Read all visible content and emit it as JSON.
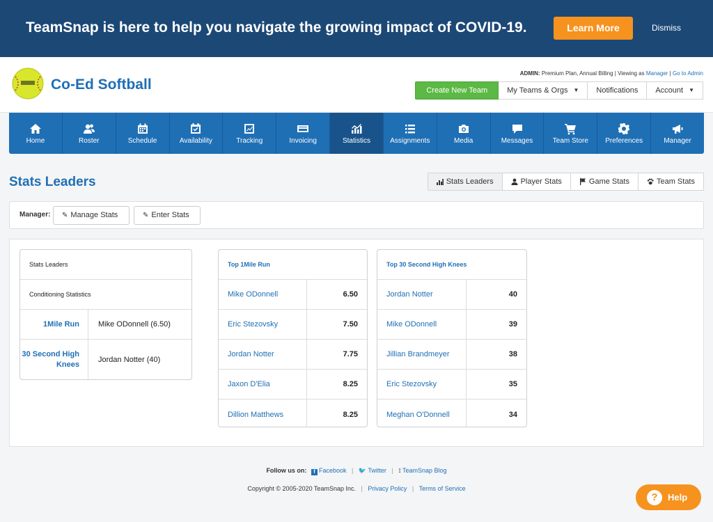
{
  "banner": {
    "text": "TeamSnap is here to help you navigate the growing impact of COVID-19.",
    "learn_more": "Learn More",
    "dismiss": "Dismiss"
  },
  "header": {
    "team_name": "Co-Ed Softball",
    "admin_prefix": "ADMIN:",
    "admin_plan": " Premium Plan, Annual Billing | Viewing as ",
    "viewing_as": "Manager",
    "admin_sep": " | ",
    "go_to_admin": "Go to Admin",
    "create_team": "Create New Team",
    "my_teams": "My Teams & Orgs",
    "notifications": "Notifications",
    "account": "Account"
  },
  "nav": {
    "items": [
      {
        "label": "Home",
        "icon": "home-icon"
      },
      {
        "label": "Roster",
        "icon": "roster-icon"
      },
      {
        "label": "Schedule",
        "icon": "calendar-icon"
      },
      {
        "label": "Availability",
        "icon": "availability-icon"
      },
      {
        "label": "Tracking",
        "icon": "tracking-icon"
      },
      {
        "label": "Invoicing",
        "icon": "credit-card-icon"
      },
      {
        "label": "Statistics",
        "icon": "statistics-icon",
        "active": true
      },
      {
        "label": "Assignments",
        "icon": "list-icon"
      },
      {
        "label": "Media",
        "icon": "camera-icon"
      },
      {
        "label": "Messages",
        "icon": "message-icon"
      },
      {
        "label": "Team Store",
        "icon": "cart-icon"
      },
      {
        "label": "Preferences",
        "icon": "gear-icon"
      },
      {
        "label": "Manager",
        "icon": "megaphone-icon"
      }
    ]
  },
  "page": {
    "title": "Stats Leaders",
    "tabs": [
      "Stats Leaders",
      "Player Stats",
      "Game Stats",
      "Team Stats"
    ]
  },
  "manager_bar": {
    "label": "Manager:",
    "manage_stats": "Manage Stats",
    "enter_stats": "Enter Stats"
  },
  "summary": {
    "header": "Stats Leaders",
    "subheader": "Conditioning Statistics",
    "rows": [
      {
        "stat": "1Mile Run",
        "leader": "Mike ODonnell (6.50)"
      },
      {
        "stat": "30 Second High Knees",
        "leader": "Jordan Notter (40)"
      }
    ]
  },
  "boards": [
    {
      "title": "Top 1Mile Run",
      "rows": [
        {
          "name": "Mike ODonnell",
          "value": "6.50"
        },
        {
          "name": "Eric Stezovsky",
          "value": "7.50"
        },
        {
          "name": "Jordan Notter",
          "value": "7.75"
        },
        {
          "name": "Jaxon D'Elia",
          "value": "8.25"
        },
        {
          "name": "Dillion Matthews",
          "value": "8.25"
        }
      ]
    },
    {
      "title": "Top 30 Second High Knees",
      "rows": [
        {
          "name": "Jordan Notter",
          "value": "40"
        },
        {
          "name": "Mike ODonnell",
          "value": "39"
        },
        {
          "name": "Jillian Brandmeyer",
          "value": "38"
        },
        {
          "name": "Eric Stezovsky",
          "value": "35"
        },
        {
          "name": "Meghan O'Donnell",
          "value": "34"
        }
      ]
    }
  ],
  "footer": {
    "follow_label": "Follow us on:",
    "facebook": "Facebook",
    "twitter": "Twitter",
    "blog": "TeamSnap Blog",
    "copyright": "Copyright © 2005-2020 TeamSnap Inc.",
    "privacy": "Privacy Policy",
    "terms": "Terms of Service"
  },
  "help": {
    "label": "Help"
  },
  "colors": {
    "banner": "#1c4876",
    "brand_blue": "#1f6fb5",
    "orange": "#f6921e",
    "green": "#5cb945"
  }
}
